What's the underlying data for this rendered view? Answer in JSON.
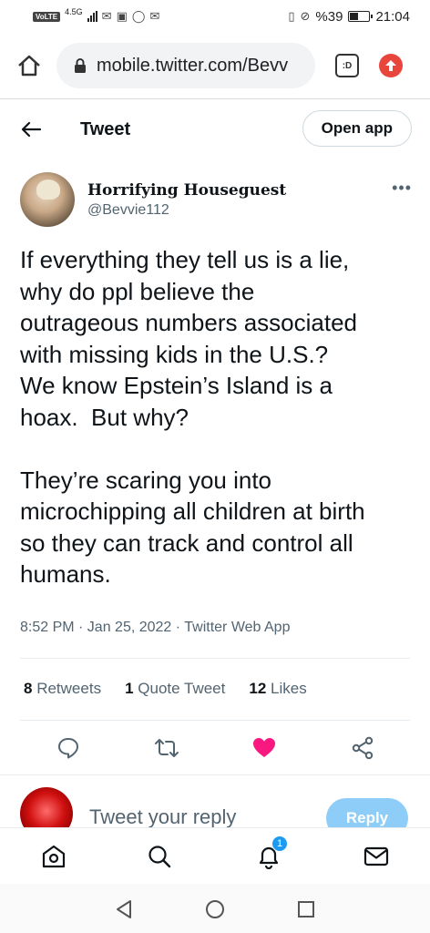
{
  "status_bar": {
    "volte": "VoLTE",
    "network": "4.5G",
    "battery_percent": "%39",
    "time": "21:04"
  },
  "browser": {
    "url": "mobile.twitter.com/Bevv",
    "tabs_label": ":D"
  },
  "header": {
    "title": "Tweet",
    "open_app": "Open app"
  },
  "tweet": {
    "display_name": "Horrifying Houseguest",
    "handle": "@Bevvie112",
    "text": "If everything they tell us is a lie,\nwhy do ppl believe the\noutrageous numbers associated\nwith missing kids in the U.S.?\nWe know Epstein’s Island is a\nhoax.  But why?\n\nThey’re scaring you into\nmicrochipping all children at birth\nso they can track and control all\nhumans.",
    "meta": "8:52 PM · Jan 25, 2022 · Twitter Web App",
    "stats": {
      "retweets_count": "8",
      "retweets_label": "Retweets",
      "quotes_count": "1",
      "quotes_label": "Quote Tweet",
      "likes_count": "12",
      "likes_label": "Likes"
    }
  },
  "reply": {
    "placeholder": "Tweet your reply",
    "button": "Reply"
  },
  "bottom_nav": {
    "notification_badge": "1"
  },
  "colors": {
    "like_active": "#f91880",
    "twitter_blue": "#1d9bf0",
    "reply_button_disabled": "#8ecdf7"
  }
}
